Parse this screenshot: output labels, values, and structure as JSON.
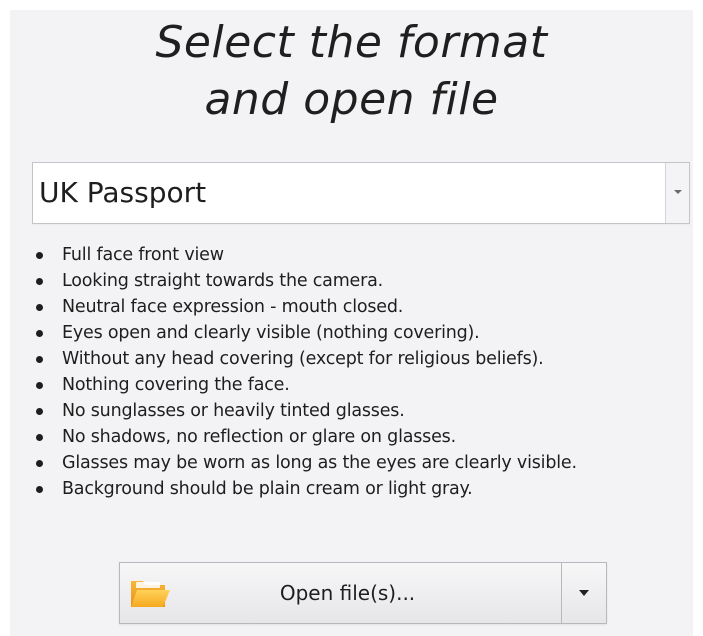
{
  "header": {
    "title_line1": "Select the format",
    "title_line2": "and open file"
  },
  "format_select": {
    "selected_value": "UK Passport",
    "dropdown_icon": "chevron-down-icon"
  },
  "requirements": [
    "Full face front view",
    "Looking straight towards the camera.",
    "Neutral face expression - mouth closed.",
    "Eyes open and clearly visible (nothing covering).",
    "Without any head covering (except for religious beliefs).",
    "Nothing covering the face.",
    "No sunglasses or heavily tinted glasses.",
    "No shadows, no reflection or glare on glasses.",
    "Glasses may be worn as long as the eyes are clearly visible.",
    "Background should be plain cream or light gray."
  ],
  "open_button": {
    "label": "Open file(s)...",
    "icon": "folder-icon",
    "menu_icon": "chevron-down-icon"
  },
  "colors": {
    "panel_background": "#f3f3f5",
    "folder_accent": "#f5a623"
  }
}
